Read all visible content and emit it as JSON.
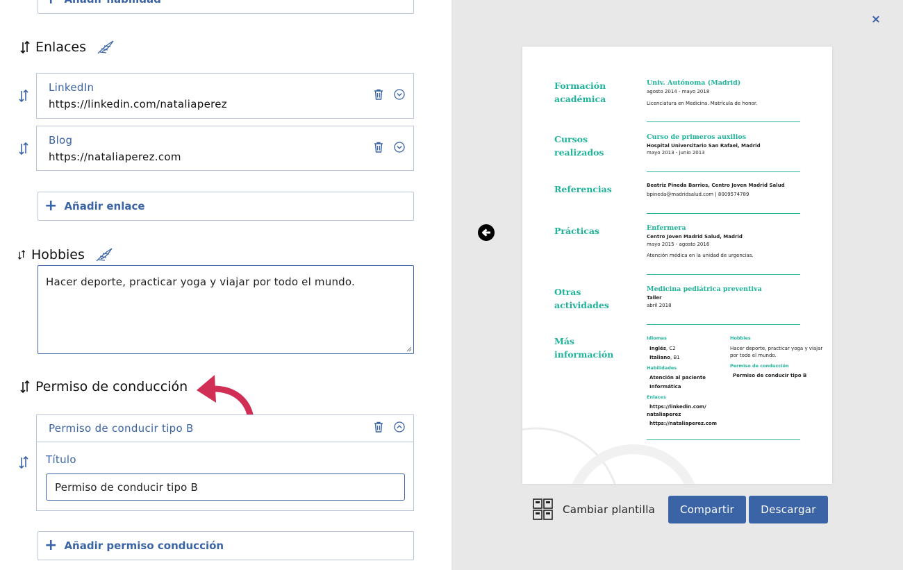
{
  "editor": {
    "top_add_button": "Añadir habilidad",
    "links": {
      "title": "Enlaces",
      "items": [
        {
          "label": "LinkedIn",
          "value": "https://linkedin.com/nataliaperez"
        },
        {
          "label": "Blog",
          "value": "https://nataliaperez.com"
        }
      ],
      "add_button": "Añadir enlace"
    },
    "hobbies": {
      "title": "Hobbies",
      "text": "Hacer deporte, practicar yoga y viajar por todo el mundo."
    },
    "license": {
      "title": "Permiso de conducción",
      "item_label": "Permiso de conducir tipo B",
      "field_label": "Título",
      "field_value": "Permiso de conducir tipo B",
      "add_button": "Añadir permiso conducción"
    },
    "add_symbol": "+"
  },
  "preview": {
    "close_symbol": "×",
    "template_button": "Cambiar plantilla",
    "share_button": "Compartir",
    "download_button": "Descargar",
    "accent_color": "#1fb39a",
    "brand_color": "#3b64a6",
    "cv": {
      "education": {
        "heading1": "Formación",
        "heading2": "académica",
        "title": "Univ. Autónoma (Madrid)",
        "date": "agosto 2014 - mayo 2018",
        "desc": "Licenciatura en Medicina. Matrícula de honor."
      },
      "courses": {
        "heading1": "Cursos",
        "heading2": "realizados",
        "title": "Curso de primeros auxilios",
        "place": "Hospital Universitario San Rafael, Madrid",
        "date": "mayo 2013 - junio 2013"
      },
      "references": {
        "heading": "Referencias",
        "name": "Beatriz Pineda Barrios, Centro Joven Madrid Salud",
        "contact": "bpineda@madridsalud.com | 8009574789"
      },
      "practices": {
        "heading": "Prácticas",
        "title": "Enfermera",
        "place": "Centro Joven Madrid Salud, Madrid",
        "date": "mayo 2015 - agosto 2016",
        "desc": "Atención médica en la unidad de urgencias."
      },
      "other": {
        "heading1": "Otras",
        "heading2": "actividades",
        "title": "Medicina pediátrica preventiva",
        "type": "Taller",
        "date": "abril 2018"
      },
      "more": {
        "heading1": "Más",
        "heading2": "información",
        "languages_head": "Idiomas",
        "lang1_name": "Inglés",
        "lang1_level": ", C2",
        "lang2_name": "Italiano",
        "lang2_level": ", B1",
        "skills_head": "Habilidades",
        "skill1": "Atención al paciente",
        "skill2": "Informática",
        "links_head": "Enlaces",
        "link1a": "https://linkedin.com/",
        "link1b": "nataliaperez",
        "link2": "https://nataliaperez.com",
        "hobbies_head": "Hobbies",
        "hobbies1": "Hacer deporte, practicar yoga y viajar",
        "hobbies2": "por todo el mundo.",
        "license_head": "Permiso de conducción",
        "license_value": "Permiso de conducir tipo B"
      }
    }
  }
}
